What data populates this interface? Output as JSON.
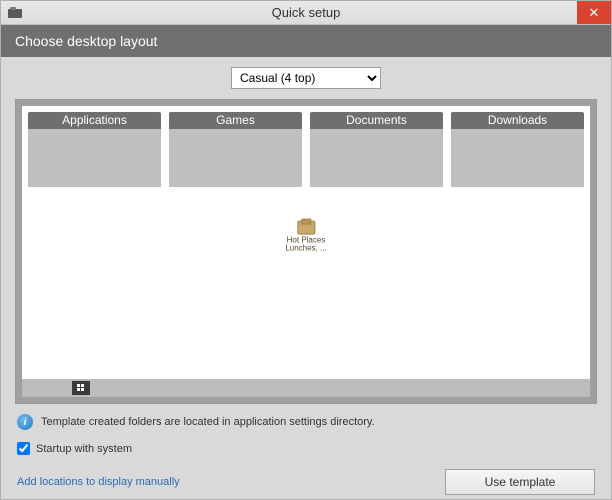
{
  "titlebar": {
    "title": "Quick setup",
    "close_glyph": "✕"
  },
  "subheader": "Choose desktop layout",
  "layout_select": {
    "selected": "Casual (4 top)"
  },
  "folders": [
    {
      "label": "Applications"
    },
    {
      "label": "Games"
    },
    {
      "label": "Documents"
    },
    {
      "label": "Downloads"
    }
  ],
  "desktop_icon": {
    "line1": "Hot Places",
    "line2": "Lunches, ..."
  },
  "info_text": "Template created folders are located in application settings directory.",
  "startup_checkbox": {
    "label": "Startup with system",
    "checked": true
  },
  "manual_link": "Add locations to display manually",
  "use_template_btn": "Use template"
}
